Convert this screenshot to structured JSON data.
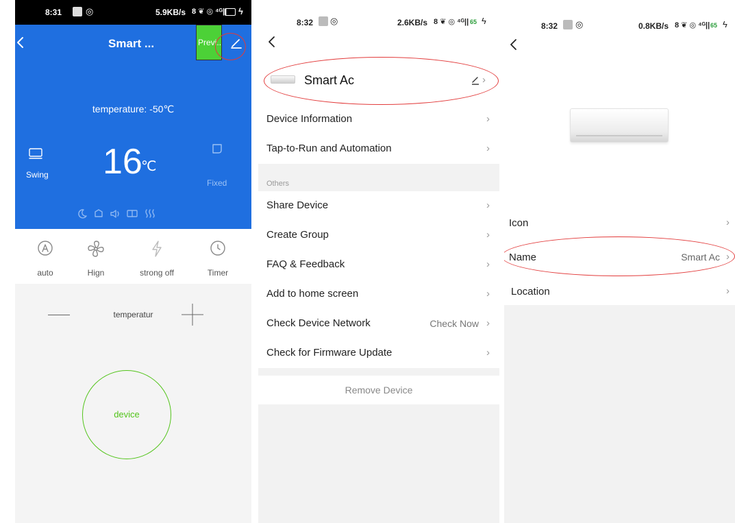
{
  "panel1": {
    "status": {
      "time": "8:31",
      "network": "5.9KB/s",
      "signal": "46"
    },
    "header": {
      "title": "Smart ...",
      "preview_label": "Previ..."
    },
    "temperature_label": "temperature: -50℃",
    "set_temp": "16",
    "temp_unit": "℃",
    "swing_label": "Swing",
    "fixed_label": "Fixed",
    "modes": [
      {
        "label": "auto",
        "icon": "auto-mode-icon"
      },
      {
        "label": "Hign",
        "icon": "fan-icon"
      },
      {
        "label": "strong off",
        "icon": "lightning-icon"
      },
      {
        "label": "Timer",
        "icon": "clock-icon"
      }
    ],
    "temp_control_label": "temperatur",
    "power_label": "device",
    "colors": {
      "blue": "#1f6fe0",
      "green": "#52c41a",
      "preview_bg": "#4cd137"
    }
  },
  "panel2": {
    "status": {
      "time": "8:32",
      "network": "2.6KB/s",
      "signal": "65"
    },
    "device_name": "Smart Ac",
    "rows_top": [
      {
        "label": "Device Information"
      },
      {
        "label": "Tap-to-Run and Automation"
      }
    ],
    "section_label": "Others",
    "rows_others": [
      {
        "label": "Share Device"
      },
      {
        "label": "Create Group"
      },
      {
        "label": "FAQ & Feedback"
      },
      {
        "label": "Add to home screen"
      },
      {
        "label": "Check Device Network",
        "value": "Check Now"
      },
      {
        "label": "Check for Firmware Update"
      }
    ],
    "remove_label": "Remove Device"
  },
  "panel3": {
    "status": {
      "time": "8:32",
      "network": "0.8KB/s",
      "signal": "65"
    },
    "rows": [
      {
        "label": "Icon",
        "value": ""
      },
      {
        "label": "Name",
        "value": "Smart Ac"
      },
      {
        "label": "Location",
        "value": ""
      }
    ]
  }
}
